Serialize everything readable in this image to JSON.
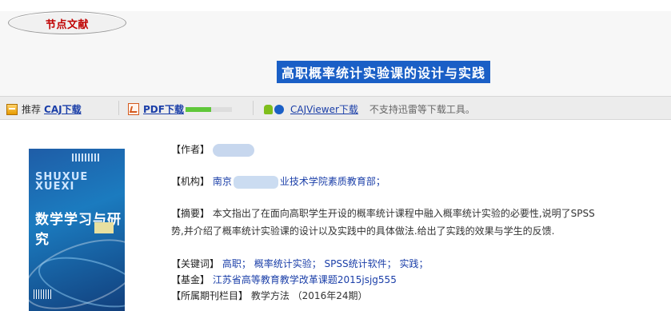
{
  "section": {
    "tab_label": "节点文献"
  },
  "article": {
    "title": "高职概率统计实验课的设计与实践"
  },
  "download": {
    "recommend_label": "推荐",
    "caj_link": "CAJ下载",
    "pdf_link": "PDF下载",
    "pdf_progress_fraction": 0.55,
    "viewer_link": "CAJViewer下载",
    "note": "不支持迅雷等下载工具。"
  },
  "cover": {
    "title_en_line1": "SHUXUE",
    "title_en_line2": "XUEXI",
    "title_cn": "数学学习与研究"
  },
  "meta": {
    "author_label": "【作者】",
    "author_value": "",
    "org_label": "【机构】",
    "org_value_start": "南京",
    "org_value_end": "业技术学院素质教育部；",
    "abstract_label": "【摘要】",
    "abstract_line1": "本文指出了在面向高职学生开设的概率统计课程中融入概率统计实验的必要性,说明了SPSS",
    "abstract_line2": "势,并介绍了概率统计实验课的设计以及实践中的具体做法.给出了实践的效果与学生的反馈.",
    "keywords_label": "【关键词】",
    "keywords": [
      "高职；",
      "概率统计实验；",
      "SPSS统计软件；",
      "实践；"
    ],
    "fund_label": "【基金】",
    "fund_value": "江苏省高等教育教学改革课题2015jsjg555",
    "journal_label": "【所属期刊栏目】",
    "journal_value": "教学方法 （2016年24期）"
  },
  "colors": {
    "link": "#1a3ea8",
    "title_bg": "#1a5fc6",
    "tab_text": "#c00000",
    "progress": "#5fc73a"
  }
}
